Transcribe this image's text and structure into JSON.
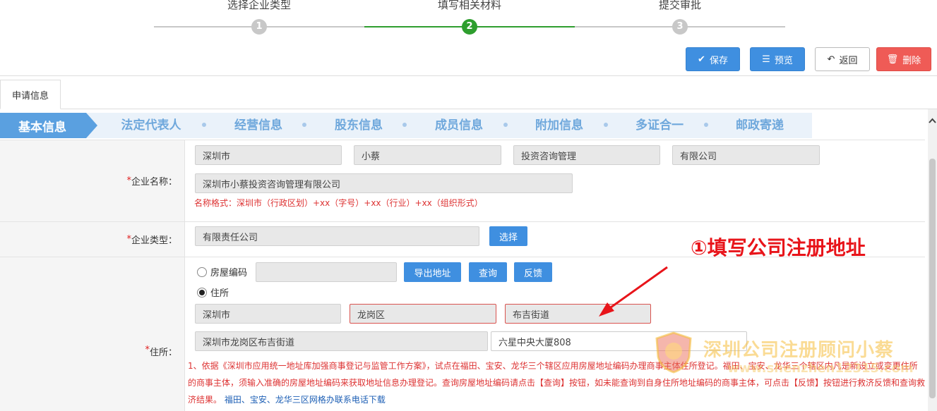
{
  "stepper": {
    "steps": [
      {
        "number": "1",
        "label": "选择企业类型",
        "state": "done"
      },
      {
        "number": "2",
        "label": "填写相关材料",
        "state": "active"
      },
      {
        "number": "3",
        "label": "提交审批",
        "state": "pending"
      }
    ],
    "colors": {
      "active": "#2e9e2e",
      "inactive": "#c8c8c8"
    }
  },
  "toolbar": {
    "save_label": "保存",
    "preview_label": "预览",
    "back_label": "返回",
    "delete_label": "删除"
  },
  "tabs": {
    "application_info": "申请信息"
  },
  "sections": [
    {
      "label": "基本信息",
      "active": true
    },
    {
      "label": "法定代表人"
    },
    {
      "label": "经营信息"
    },
    {
      "label": "股东信息"
    },
    {
      "label": "成员信息"
    },
    {
      "label": "附加信息"
    },
    {
      "label": "多证合一"
    },
    {
      "label": "邮政寄递"
    }
  ],
  "company_name": {
    "label": "企业名称：",
    "required_mark": "*",
    "parts": [
      "深圳市",
      "小蔡",
      "投资咨询管理",
      "有限公司"
    ],
    "full_name": "深圳市小蔡投资咨询管理有限公司",
    "format_hint": "名称格式：深圳市（行政区划）+xx（字号）+xx（行业）+xx（组织形式）"
  },
  "company_type": {
    "label": "企业类型：",
    "required_mark": "*",
    "value": "有限责任公司",
    "select_label": "选择"
  },
  "address": {
    "label": "住所：",
    "required_mark": "*",
    "radio_house_code": "房屋编码",
    "radio_residence": "住所",
    "selected": "住所",
    "house_code_value": "",
    "export_label": "导出地址",
    "query_label": "查询",
    "feedback_label": "反馈",
    "city": "深圳市",
    "district": "龙岗区",
    "street": "布吉街道",
    "combined": "深圳市龙岗区布吉街道",
    "detail": "六星中央大厦808",
    "note": "1、依据《深圳市应用统一地址库加强商事登记与监管工作方案》，试点在福田、宝安、龙华三个辖区应用房屋地址编码办理商事主体住所登记。福田、宝安、龙华三个辖区内凡是新设立或变更住所的商事主体，须输入准确的房屋地址编码来获取地址信息办理登记。查询房屋地址编码请点击【查询】按钮，如未能查询到自身住所地址编码的商事主体，可点击【反馈】按钮进行救济反馈和查询救济结果。",
    "note_link": "福田、宝安、龙华三区网格办联系电话下载"
  },
  "annotation": "①填写公司注册地址",
  "watermark": {
    "title": "深圳公司注册顾问小蔡",
    "url": "www.shenzhen12315.com"
  }
}
